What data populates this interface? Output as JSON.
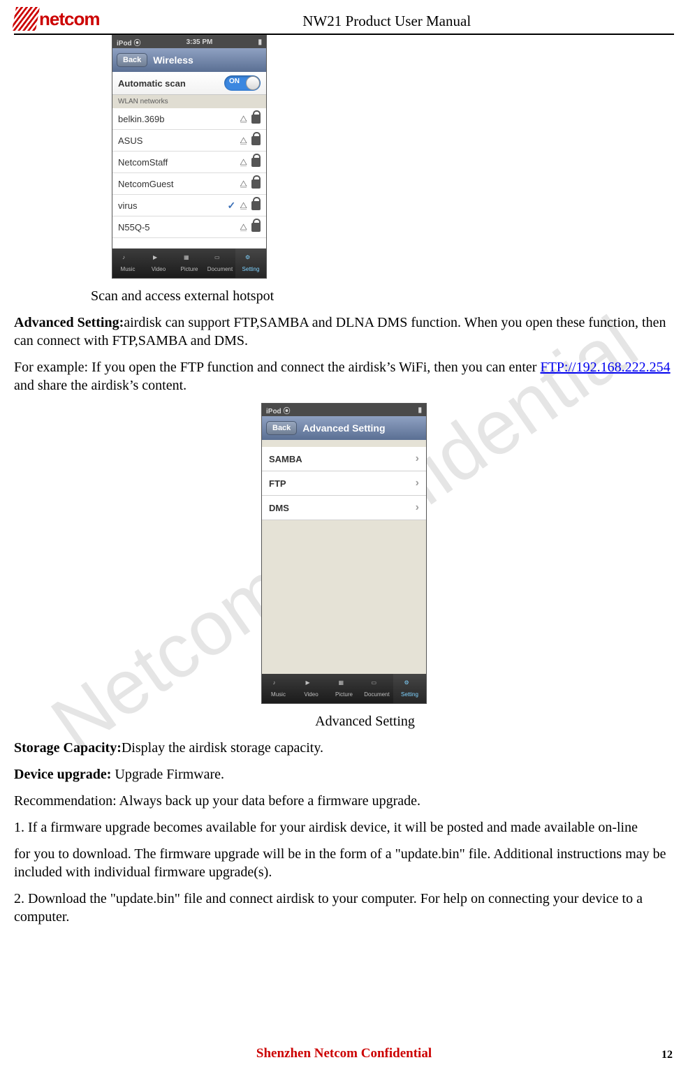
{
  "watermark": "Netcom Confidential",
  "header": {
    "title": "NW21 Product User Manual",
    "logo_text": "netcom"
  },
  "footer": {
    "text": "Shenzhen Netcom Confidential",
    "page": "12"
  },
  "screenshot1": {
    "status_left": "iPod",
    "status_time": "3:35 PM",
    "back": "Back",
    "title": "Wireless",
    "auto_label": "Automatic scan",
    "toggle": "ON",
    "section": "WLAN networks",
    "networks": [
      {
        "name": "belkin.369b",
        "connected": false,
        "locked": true
      },
      {
        "name": "ASUS",
        "connected": false,
        "locked": true
      },
      {
        "name": "NetcomStaff",
        "connected": false,
        "locked": true
      },
      {
        "name": "NetcomGuest",
        "connected": false,
        "locked": true
      },
      {
        "name": "virus",
        "connected": true,
        "locked": true
      },
      {
        "name": "N55Q-5",
        "connected": false,
        "locked": true
      }
    ],
    "tabs": [
      "Music",
      "Video",
      "Picture",
      "Document",
      "Setting"
    ]
  },
  "caption1": "Scan and access external hotspot",
  "para1_label": "Advanced Setting:",
  "para1_text": "airdisk can support FTP,SAMBA and DLNA DMS function. When you open these function, then can connect with FTP,SAMBA and DMS.",
  "para2_pre": "For example: If you open the FTP function and connect the airdisk’s WiFi, then you can enter ",
  "para2_link": "FTP://192.168.222.254",
  "para2_post": " and share the airdisk’s content.",
  "screenshot2": {
    "status_left": "iPod",
    "back": "Back",
    "title": "Advanced Setting",
    "items": [
      "SAMBA",
      "FTP",
      "DMS"
    ],
    "tabs": [
      "Music",
      "Video",
      "Picture",
      "Document",
      "Setting"
    ]
  },
  "caption2": "Advanced Setting",
  "para3_label": "Storage Capacity:",
  "para3_text": "Display the airdisk storage capacity.",
  "para4_label": "Device upgrade:",
  "para4_text": " Upgrade Firmware.",
  "para5": "Recommendation: Always back up your data before a firmware upgrade.",
  "para6": "1. If a firmware upgrade becomes available for your airdisk device, it will be posted and made available on-line",
  "para7": "for you to download. The firmware upgrade will be in the form of a \"update.bin\" file. Additional instructions may be included with individual firmware upgrade(s).",
  "para8": "2.  Download the \"update.bin\" file and connect airdisk to your computer. For help on connecting your device to a computer."
}
